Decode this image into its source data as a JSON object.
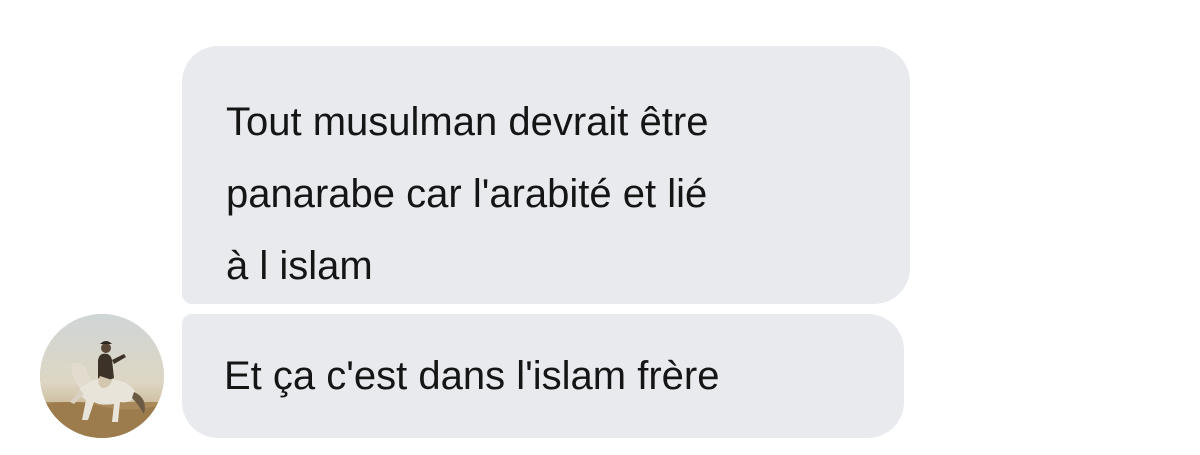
{
  "conversation": {
    "messages": [
      {
        "text": "Tout musulman devrait être\npanarabe car l'arabité et lié\nà l islam"
      },
      {
        "text": "Et ça c'est dans l'islam frère"
      }
    ]
  },
  "colors": {
    "background": "#ffffff",
    "bubble": "#e8eaee",
    "text": "#151515"
  },
  "avatar": {
    "icon": "avatar-horse-rider-painting"
  }
}
